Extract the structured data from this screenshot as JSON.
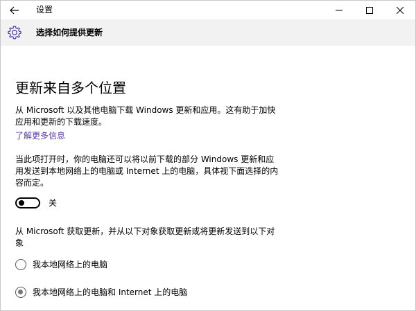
{
  "window": {
    "title": "设置",
    "back_icon": "arrow-left-icon",
    "minimize_icon": "minimize-icon",
    "maximize_icon": "maximize-icon",
    "close_icon": "close-icon"
  },
  "header": {
    "icon": "gear-icon",
    "title": "选择如何提供更新"
  },
  "main": {
    "heading": "更新来自多个位置",
    "description": "从 Microsoft 以及其他电脑下载 Windows 更新和应用。这有助于加快应用和更新的下载速度。",
    "learn_more": "了解更多信息",
    "toggle_description": "当此项打开时，你的电脑还可以将以前下载的部分 Windows 更新和应用发送到本地网络上的电脑或 Internet 上的电脑，具体视下面选择的内容而定。",
    "toggle": {
      "state": "off",
      "label": "关"
    },
    "options_description": "从 Microsoft 获取更新，并从以下对象获取更新或将更新发送到以下对象",
    "options": [
      {
        "label": "我本地网络上的电脑",
        "selected": false
      },
      {
        "label": "我本地网络上的电脑和 Internet 上的电脑",
        "selected": true
      }
    ]
  },
  "colors": {
    "accent_link": "#5a3ea9",
    "gear": "#5a3ea9",
    "header_bg": "#f2f2f2"
  }
}
